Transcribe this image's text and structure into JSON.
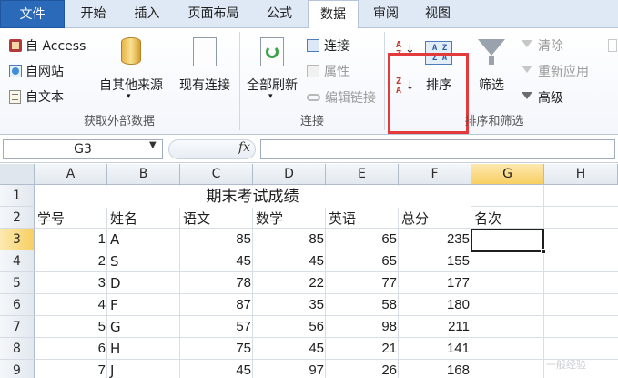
{
  "tabs": [
    {
      "label": "文件"
    },
    {
      "label": "开始"
    },
    {
      "label": "插入"
    },
    {
      "label": "页面布局"
    },
    {
      "label": "公式"
    },
    {
      "label": "数据"
    },
    {
      "label": "审阅"
    },
    {
      "label": "视图"
    }
  ],
  "ribbon": {
    "get_external": {
      "access": "自 Access",
      "web": "自网站",
      "text": "自文本",
      "other": "自其他来源",
      "existing": "现有连接",
      "group_label": "获取外部数据"
    },
    "connections": {
      "refresh_all": "全部刷新",
      "connections": "连接",
      "properties": "属性",
      "edit_links": "编辑链接",
      "group_label": "连接"
    },
    "sort_filter": {
      "sort_az": "A Z",
      "sort_za": "Z A",
      "sort": "排序",
      "sort_icon_text": "A Z Z A",
      "filter": "筛选",
      "clear": "清除",
      "reapply": "重新应用",
      "advanced": "高级",
      "group_label": "排序和筛选"
    }
  },
  "formula_bar": {
    "name_box": "G3",
    "fx": "fx",
    "formula": ""
  },
  "grid": {
    "columns": [
      "A",
      "B",
      "C",
      "D",
      "E",
      "F",
      "G",
      "H"
    ],
    "rows": [
      "1",
      "2",
      "3",
      "4",
      "5",
      "6",
      "7",
      "8",
      "9"
    ],
    "selected_column": "G",
    "selected_row": "3",
    "title": "期末考试成绩",
    "headers": [
      "学号",
      "姓名",
      "语文",
      "数学",
      "英语",
      "总分",
      "名次"
    ],
    "data": [
      [
        "1",
        "A",
        "85",
        "85",
        "65",
        "235"
      ],
      [
        "2",
        "S",
        "45",
        "45",
        "65",
        "155"
      ],
      [
        "3",
        "D",
        "78",
        "22",
        "77",
        "177"
      ],
      [
        "4",
        "F",
        "87",
        "35",
        "58",
        "180"
      ],
      [
        "5",
        "G",
        "57",
        "56",
        "98",
        "211"
      ],
      [
        "6",
        "H",
        "75",
        "45",
        "21",
        "141"
      ],
      [
        "7",
        "J",
        "45",
        "97",
        "26",
        "168"
      ]
    ]
  },
  "watermark": "一般经验",
  "colors": {
    "file_tab": "#2a6ab8",
    "highlight_box": "#e33b3b",
    "selected_header": "#f7cf62"
  }
}
